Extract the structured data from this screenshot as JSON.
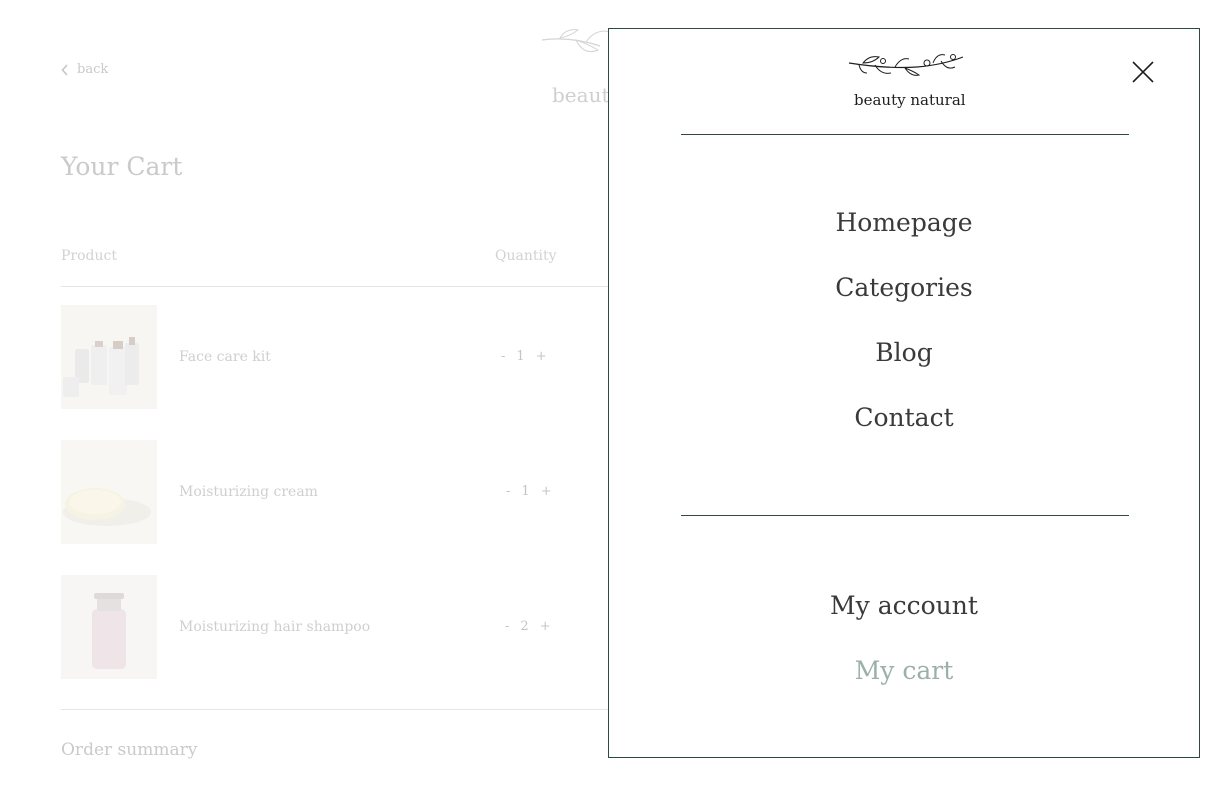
{
  "background": {
    "back_label": "back",
    "brand": "beauty natural",
    "cart_title": "Your Cart",
    "columns": {
      "product": "Product",
      "quantity": "Quantity"
    },
    "items": [
      {
        "name": "Face care kit",
        "qty": "1",
        "minus": "-",
        "plus": "+"
      },
      {
        "name": "Moisturizing cream",
        "qty": "1",
        "minus": "-",
        "plus": "+"
      },
      {
        "name": "Moisturizing hair shampoo",
        "qty": "2",
        "minus": "-",
        "plus": "+"
      }
    ],
    "order_summary": "Order summary"
  },
  "menu": {
    "brand": "beauty natural",
    "close_icon": "close-icon",
    "nav": [
      {
        "label": "Homepage"
      },
      {
        "label": "Categories"
      },
      {
        "label": "Blog"
      },
      {
        "label": "Contact"
      }
    ],
    "account": [
      {
        "label": "My account"
      },
      {
        "label": "My cart",
        "active": true
      }
    ]
  },
  "colors": {
    "accent_border": "#2f4a45",
    "active_link": "#9bb0aa"
  }
}
